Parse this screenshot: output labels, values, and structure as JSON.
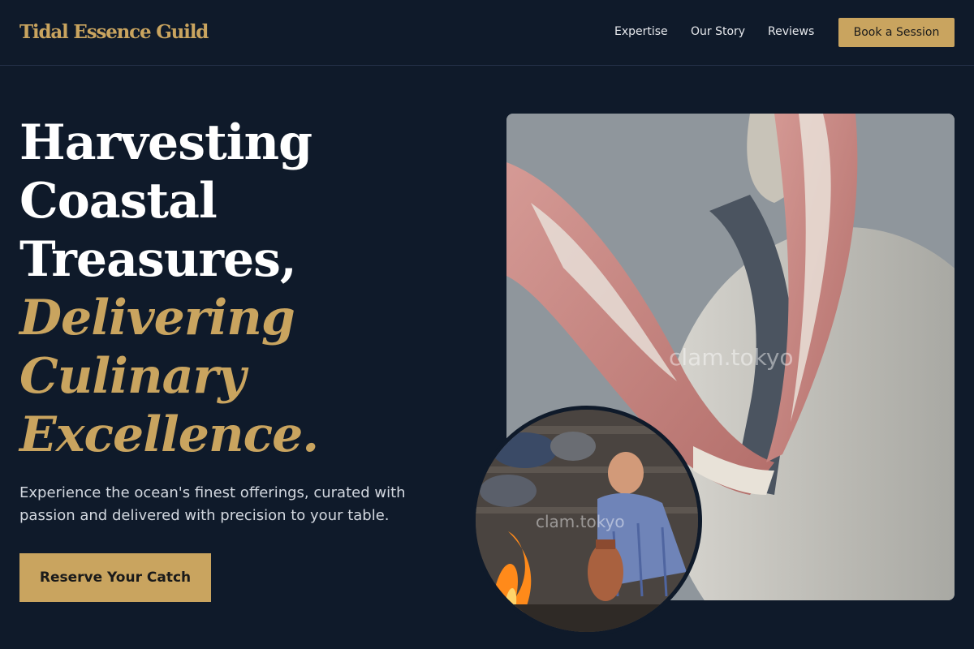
{
  "nav": {
    "logo": "Tidal Essence Guild",
    "links": [
      "Expertise",
      "Our Story",
      "Reviews"
    ],
    "cta": "Book a Session"
  },
  "hero": {
    "title_lines": [
      "Harvesting",
      "Coastal",
      "Treasures,"
    ],
    "accent_lines": [
      "Delivering",
      "Culinary",
      "Excellence."
    ],
    "subtitle": "Experience the ocean's finest offerings, curated with passion and delivered with precision to your table.",
    "cta": "Reserve Your Catch"
  },
  "images": {
    "main_watermark": "clam.tokyo",
    "circle_watermark": "clam.tokyo"
  },
  "colors": {
    "background": "#0f1a2a",
    "accent": "#c9a45f",
    "text": "#ffffff",
    "muted": "#d3d8e0"
  }
}
